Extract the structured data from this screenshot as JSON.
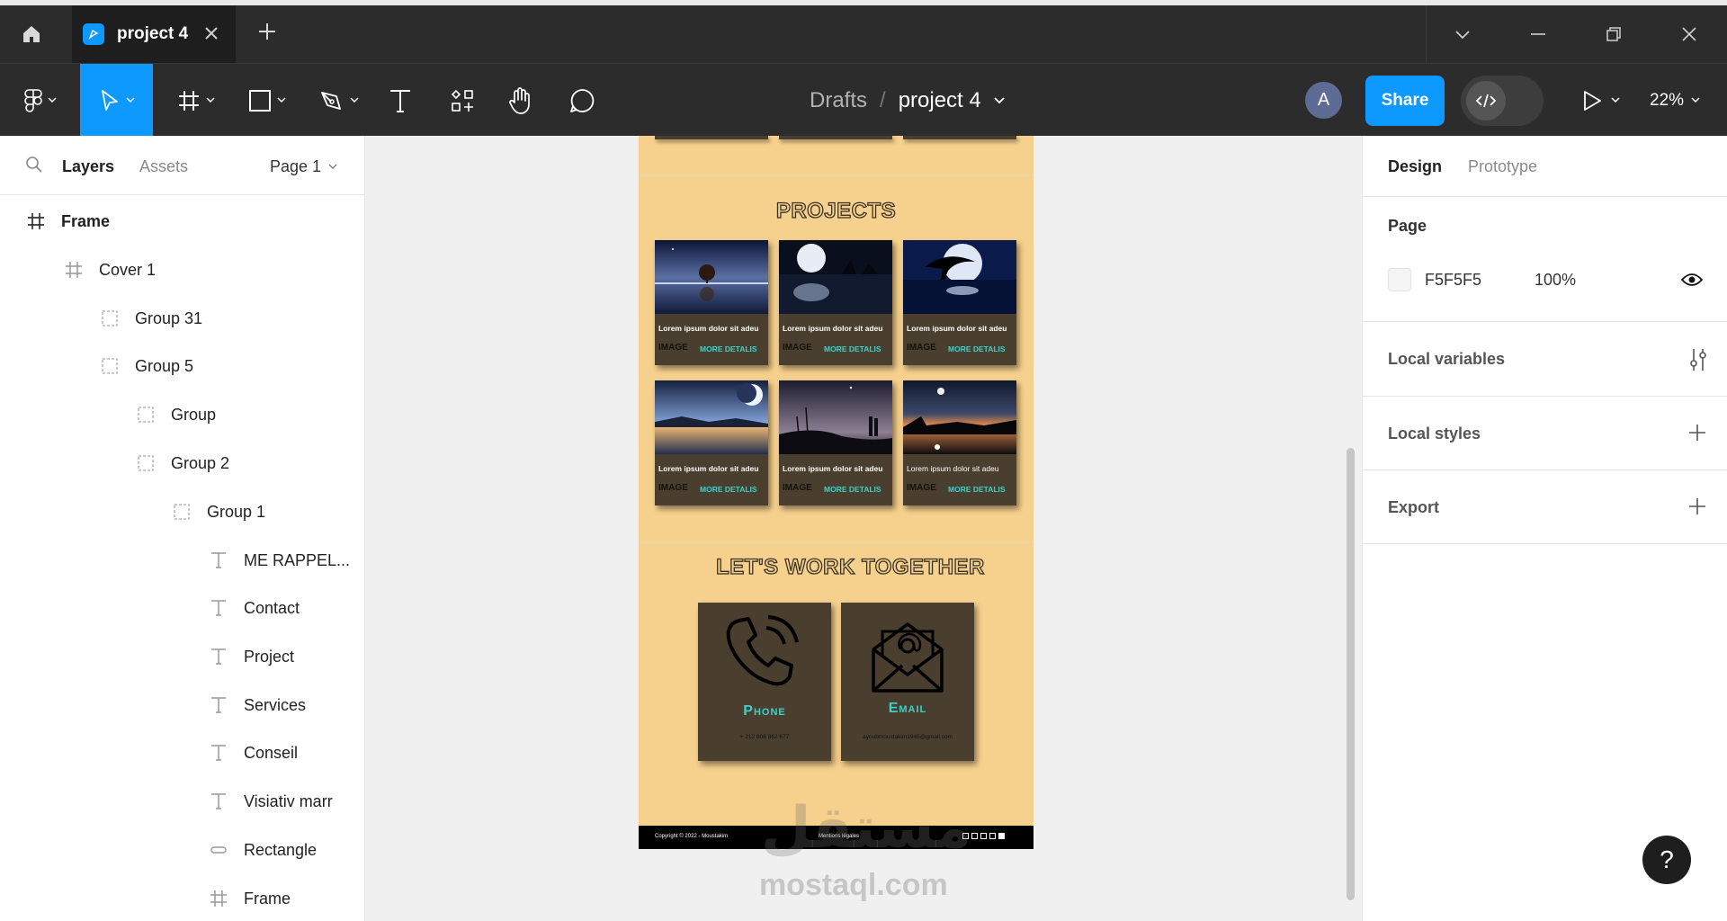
{
  "titlebar": {
    "tab_label": "project 4",
    "icons": [
      "home-icon",
      "figma-file-icon",
      "close-icon",
      "plus-icon",
      "chevron-down-icon",
      "minimize-icon",
      "restore-icon",
      "window-close-icon"
    ]
  },
  "toolbar": {
    "breadcrumb_drafts": "Drafts",
    "breadcrumb_sep": "/",
    "breadcrumb_file": "project 4",
    "avatar_initial": "A",
    "share_label": "Share",
    "zoom_label": "22%",
    "tools": [
      "figma-menu-icon",
      "move-tool-icon",
      "frame-tool-icon",
      "shape-tool-icon",
      "pen-tool-icon",
      "text-tool-icon",
      "resources-icon",
      "hand-tool-icon",
      "comment-icon"
    ]
  },
  "left_panel": {
    "tab_layers": "Layers",
    "tab_assets": "Assets",
    "page_selector": "Page 1",
    "layers": [
      {
        "label": "Frame",
        "type": "frame"
      },
      {
        "label": "Cover 1",
        "type": "frame"
      },
      {
        "label": "Group 31",
        "type": "group"
      },
      {
        "label": "Group 5",
        "type": "group"
      },
      {
        "label": "Group",
        "type": "group"
      },
      {
        "label": "Group 2",
        "type": "group"
      },
      {
        "label": "Group 1",
        "type": "group"
      },
      {
        "label": "ME RAPPEL...",
        "type": "text"
      },
      {
        "label": "Contact",
        "type": "text"
      },
      {
        "label": "Project",
        "type": "text"
      },
      {
        "label": "Services",
        "type": "text"
      },
      {
        "label": "Conseil",
        "type": "text"
      },
      {
        "label": "Visiativ marr",
        "type": "text"
      },
      {
        "label": "Rectangle",
        "type": "rectangle"
      },
      {
        "label": "Frame",
        "type": "frame"
      }
    ]
  },
  "canvas": {
    "projects_title": "PROJECTS",
    "cards": [
      {
        "text": "Lorem ipsum dolor sit adeu",
        "image_label": "IMAGE",
        "more": "MORE DETALIS"
      },
      {
        "text": "Lorem ipsum dolor sit adeu",
        "image_label": "IMAGE",
        "more": "MORE DETALIS"
      },
      {
        "text": "Lorem ipsum dolor sit adeu",
        "image_label": "IMAGE",
        "more": "MORE DETALIS"
      },
      {
        "text": "Lorem ipsum dolor sit adeu",
        "image_label": "IMAGE",
        "more": "MORE DETALIS"
      },
      {
        "text": "Lorem ipsum dolor sit adeu",
        "image_label": "IMAGE",
        "more": "MORE DETALIS"
      },
      {
        "text": "Lorem ipsum dolor sit adeu",
        "image_label": "IMAGE",
        "more": "MORE DETALIS"
      }
    ],
    "work_title": "LET'S WORK TOGETHER",
    "phone_label": "Phone",
    "phone_value": "+ 212 808 862 677",
    "email_label": "Email",
    "email_value": "ayoubmoustakim1945@gmail.com",
    "footer_copyright": "Copyright © 2022 - Moustakim",
    "footer_legal": "Mentions légales",
    "watermark_arabic": "مستقل",
    "watermark_latin": "mostaql.com"
  },
  "right_panel": {
    "tab_design": "Design",
    "tab_prototype": "Prototype",
    "page_title": "Page",
    "page_color": "F5F5F5",
    "page_opacity": "100%",
    "local_variables": "Local variables",
    "local_styles": "Local styles",
    "export": "Export",
    "help": "?"
  },
  "colors": {
    "accent": "#0d99ff",
    "chrome": "#2c2c2c",
    "frame_bg": "#f6d08d",
    "card_bg": "#4a3f2e",
    "teal": "#3fd0c9",
    "pink": "#e0468a"
  }
}
